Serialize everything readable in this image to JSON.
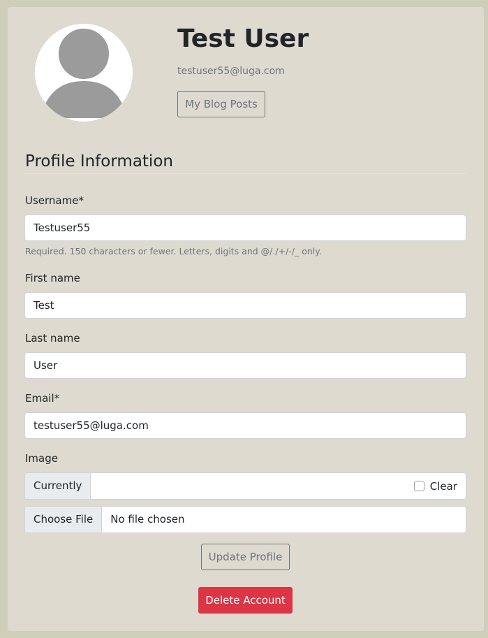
{
  "profile": {
    "name": "Test User",
    "email": "testuser55@luga.com",
    "blog_button": "My Blog Posts",
    "avatar_icon": "user-silhouette-icon"
  },
  "section": {
    "title": "Profile Information"
  },
  "form": {
    "username": {
      "label": "Username*",
      "value": "Testuser55",
      "help": "Required. 150 characters or fewer. Letters, digits and @/./+/-/_ only."
    },
    "first_name": {
      "label": "First name",
      "value": "Test"
    },
    "last_name": {
      "label": "Last name",
      "value": "User"
    },
    "email": {
      "label": "Email*",
      "value": "testuser55@luga.com"
    },
    "image": {
      "label": "Image",
      "currently_label": "Currently",
      "clear_label": "Clear",
      "clear_checked": false,
      "choose_file_label": "Choose File",
      "file_status": "No file chosen"
    }
  },
  "actions": {
    "update_label": "Update Profile",
    "delete_label": "Delete Account"
  },
  "colors": {
    "page_background": "#cfcfb9",
    "card_background": "#dedad0",
    "danger": "#dc3545",
    "muted": "#6c757d"
  }
}
